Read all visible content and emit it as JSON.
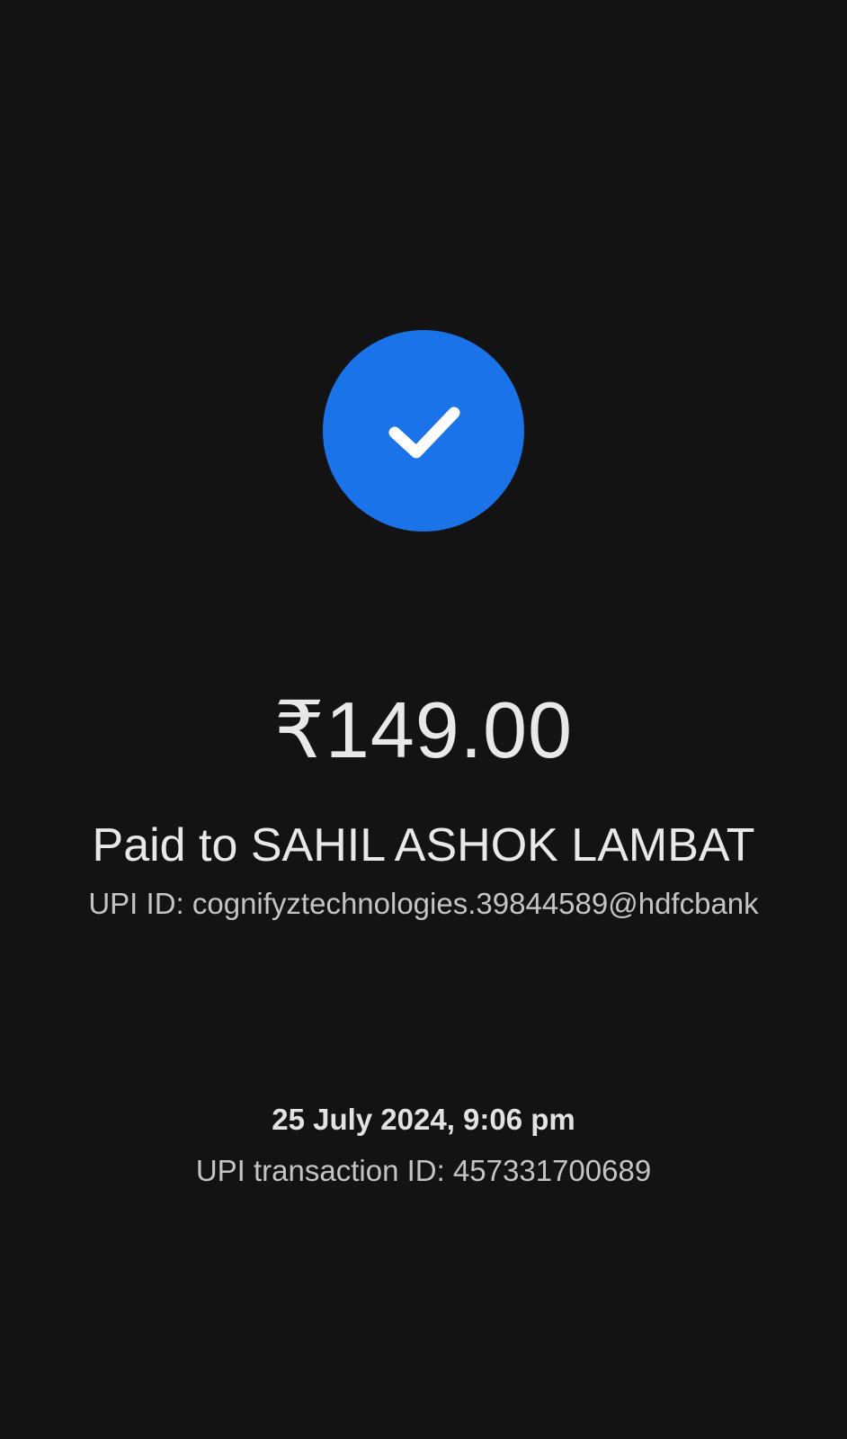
{
  "payment": {
    "status_icon": "check-icon",
    "status_color": "#1a73e8",
    "amount": "₹149.00",
    "paid_to": "Paid to SAHIL ASHOK LAMBAT",
    "upi_id": "UPI ID: cognifyztechnologies.39844589@hdfcbank",
    "datetime": "25 July 2024, 9:06 pm",
    "transaction_id": "UPI transaction ID: 457331700689"
  },
  "theme": {
    "background": "#131313",
    "text_primary": "#e8e8e8",
    "text_secondary": "#c4c4c4"
  }
}
